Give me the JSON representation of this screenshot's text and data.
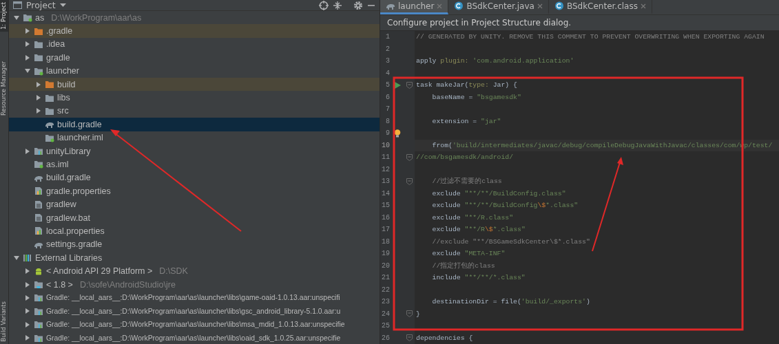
{
  "tool_strip": [
    {
      "label": "1: Project",
      "selected": true
    },
    {
      "label": "Resource Manager",
      "selected": false
    },
    {
      "label": "Build Variants",
      "selected": false
    }
  ],
  "project_panel": {
    "title": "Project",
    "tree": [
      {
        "label": "as",
        "hint": "D:\\WorkProgram\\aar\\as",
        "kind": "module",
        "expanded": true,
        "selected": false,
        "excluded": false,
        "children": [
          {
            "label": ".gradle",
            "kind": "folder",
            "expanded": false,
            "selected": false,
            "excluded": true
          },
          {
            "label": ".idea",
            "kind": "folder",
            "expanded": false,
            "selected": false,
            "excluded": false
          },
          {
            "label": "gradle",
            "kind": "folder",
            "expanded": false,
            "selected": false,
            "excluded": false
          },
          {
            "label": "launcher",
            "kind": "module",
            "expanded": true,
            "selected": false,
            "excluded": false,
            "children": [
              {
                "label": "build",
                "kind": "folder",
                "expanded": false,
                "selected": false,
                "excluded": true
              },
              {
                "label": "libs",
                "kind": "folder",
                "expanded": false,
                "selected": false,
                "excluded": false
              },
              {
                "label": "src",
                "kind": "folder",
                "expanded": false,
                "selected": false,
                "excluded": false
              },
              {
                "label": "build.gradle",
                "kind": "gradle",
                "selected": true,
                "excluded": false
              },
              {
                "label": "launcher.iml",
                "kind": "iml",
                "selected": false,
                "excluded": false
              }
            ]
          },
          {
            "label": "unityLibrary",
            "kind": "library",
            "expanded": false,
            "selected": false,
            "excluded": false
          },
          {
            "label": "as.iml",
            "kind": "iml",
            "selected": false,
            "excluded": false
          },
          {
            "label": "build.gradle",
            "kind": "gradle",
            "selected": false,
            "excluded": false
          },
          {
            "label": "gradle.properties",
            "kind": "properties",
            "selected": false,
            "excluded": false
          },
          {
            "label": "gradlew",
            "kind": "file",
            "selected": false,
            "excluded": false
          },
          {
            "label": "gradlew.bat",
            "kind": "file",
            "selected": false,
            "excluded": false
          },
          {
            "label": "local.properties",
            "kind": "properties",
            "selected": false,
            "excluded": false
          },
          {
            "label": "settings.gradle",
            "kind": "gradle",
            "selected": false,
            "excluded": false
          }
        ]
      },
      {
        "label": "External Libraries",
        "kind": "libraries",
        "expanded": true,
        "selected": false,
        "excluded": false,
        "children": [
          {
            "label": "< Android API 29 Platform >",
            "hint": "D:\\SDK",
            "kind": "android",
            "expanded": false,
            "selected": false,
            "excluded": false
          },
          {
            "label": "< 1.8 >",
            "hint": "D:\\sofe\\AndroidStudio\\jre",
            "kind": "jdk",
            "expanded": false,
            "selected": false,
            "excluded": false
          },
          {
            "label": "Gradle: __local_aars__:D:\\WorkProgram\\aar\\as\\launcher\\libs\\game-oaid-1.0.13.aar:unspecifi",
            "kind": "library",
            "expanded": false,
            "selected": false,
            "excluded": false
          },
          {
            "label": "Gradle: __local_aars__:D:\\WorkProgram\\aar\\as\\launcher\\libs\\gsc_android_library-5.1.0.aar:u",
            "kind": "library",
            "expanded": false,
            "selected": false,
            "excluded": false
          },
          {
            "label": "Gradle: __local_aars__:D:\\WorkProgram\\aar\\as\\launcher\\libs\\msa_mdid_1.0.13.aar:unspecifie",
            "kind": "library",
            "expanded": false,
            "selected": false,
            "excluded": false
          },
          {
            "label": "Gradle: __local_aars__:D:\\WorkProgram\\aar\\as\\launcher\\libs\\oaid_sdk_1.0.25.aar:unspecifie",
            "kind": "library",
            "expanded": false,
            "selected": false,
            "excluded": false
          }
        ]
      }
    ]
  },
  "editor": {
    "tabs": [
      {
        "label": "launcher",
        "kind": "gradle",
        "selected": true
      },
      {
        "label": "BSdkCenter.java",
        "kind": "class",
        "selected": false
      },
      {
        "label": "BSdkCenter.class",
        "kind": "class",
        "selected": false
      }
    ],
    "notification": "Configure project in Project Structure dialog.",
    "lines": [
      {
        "num": "1",
        "segments": [
          {
            "kind": "comment",
            "text": "// GENERATED BY UNITY. REMOVE THIS COMMENT TO PREVENT OVERWRITING WHEN EXPORTING AGAIN"
          }
        ]
      },
      {
        "num": "2"
      },
      {
        "num": "3",
        "segments": [
          {
            "kind": "plain",
            "text": "apply "
          },
          {
            "kind": "param",
            "text": "plugin: "
          },
          {
            "kind": "string",
            "text": "'com.android.application'"
          }
        ]
      },
      {
        "num": "4"
      },
      {
        "num": "5",
        "run_button": true,
        "fold": true,
        "segments": [
          {
            "kind": "plain",
            "text": "task makeJar("
          },
          {
            "kind": "param",
            "text": "type: "
          },
          {
            "kind": "plain",
            "text": "Jar) {"
          }
        ]
      },
      {
        "num": "6",
        "segments": [
          {
            "kind": "plain",
            "text": "    baseName = "
          },
          {
            "kind": "string",
            "text": "\"bsgamesdk\""
          }
        ]
      },
      {
        "num": "7"
      },
      {
        "num": "8",
        "segments": [
          {
            "kind": "plain",
            "text": "    extension = "
          },
          {
            "kind": "string",
            "text": "\"jar\""
          }
        ]
      },
      {
        "num": "9",
        "intention_bulb": true
      },
      {
        "num": "10",
        "current": true,
        "segments": [
          {
            "kind": "plain",
            "text": "    from("
          },
          {
            "kind": "string",
            "text": "'build/intermediates/javac/debug/compileDebugJavaWithJavac/classes/com/wp/test/"
          }
        ]
      },
      {
        "num": "11",
        "fold": true,
        "segments": [
          {
            "kind": "string",
            "text": "//com/bsgamesdk/android/"
          }
        ]
      },
      {
        "num": "12"
      },
      {
        "num": "13",
        "fold": true,
        "segments": [
          {
            "kind": "comment",
            "text": "    //过滤不需要的class"
          }
        ]
      },
      {
        "num": "14",
        "segments": [
          {
            "kind": "plain",
            "text": "    exclude "
          },
          {
            "kind": "string",
            "text": "\"**/**/BuildConfig.class\""
          }
        ]
      },
      {
        "num": "15",
        "segments": [
          {
            "kind": "plain",
            "text": "    exclude "
          },
          {
            "kind": "string",
            "text": "\"**/**/BuildConfig"
          },
          {
            "kind": "escape",
            "text": "\\$"
          },
          {
            "kind": "string",
            "text": "*.class\""
          }
        ]
      },
      {
        "num": "16",
        "segments": [
          {
            "kind": "plain",
            "text": "    exclude "
          },
          {
            "kind": "string",
            "text": "\"**/R.class\""
          }
        ]
      },
      {
        "num": "17",
        "segments": [
          {
            "kind": "plain",
            "text": "    exclude "
          },
          {
            "kind": "string",
            "text": "\"**/R"
          },
          {
            "kind": "escape",
            "text": "\\$"
          },
          {
            "kind": "string",
            "text": "*.class\""
          }
        ]
      },
      {
        "num": "18",
        "segments": [
          {
            "kind": "comment",
            "text": "    //exclude \"**/BSGameSdkCenter\\$*.class\""
          }
        ]
      },
      {
        "num": "19",
        "segments": [
          {
            "kind": "plain",
            "text": "    exclude "
          },
          {
            "kind": "string",
            "text": "\"META-INF\""
          }
        ]
      },
      {
        "num": "20",
        "segments": [
          {
            "kind": "comment",
            "text": "    //指定打包的class"
          }
        ]
      },
      {
        "num": "21",
        "segments": [
          {
            "kind": "plain",
            "text": "    include "
          },
          {
            "kind": "string",
            "text": "\"**/**/*.class\""
          }
        ]
      },
      {
        "num": "22"
      },
      {
        "num": "23",
        "segments": [
          {
            "kind": "plain",
            "text": "    destinationDir = file("
          },
          {
            "kind": "string",
            "text": "'build/_exports'"
          },
          {
            "kind": "plain",
            "text": ")"
          }
        ]
      },
      {
        "num": "24",
        "fold": true,
        "segments": [
          {
            "kind": "plain",
            "text": "}"
          }
        ]
      },
      {
        "num": "25"
      },
      {
        "num": "26",
        "fold": true,
        "segments": [
          {
            "kind": "plain",
            "text": "dependencies {"
          }
        ]
      }
    ]
  }
}
